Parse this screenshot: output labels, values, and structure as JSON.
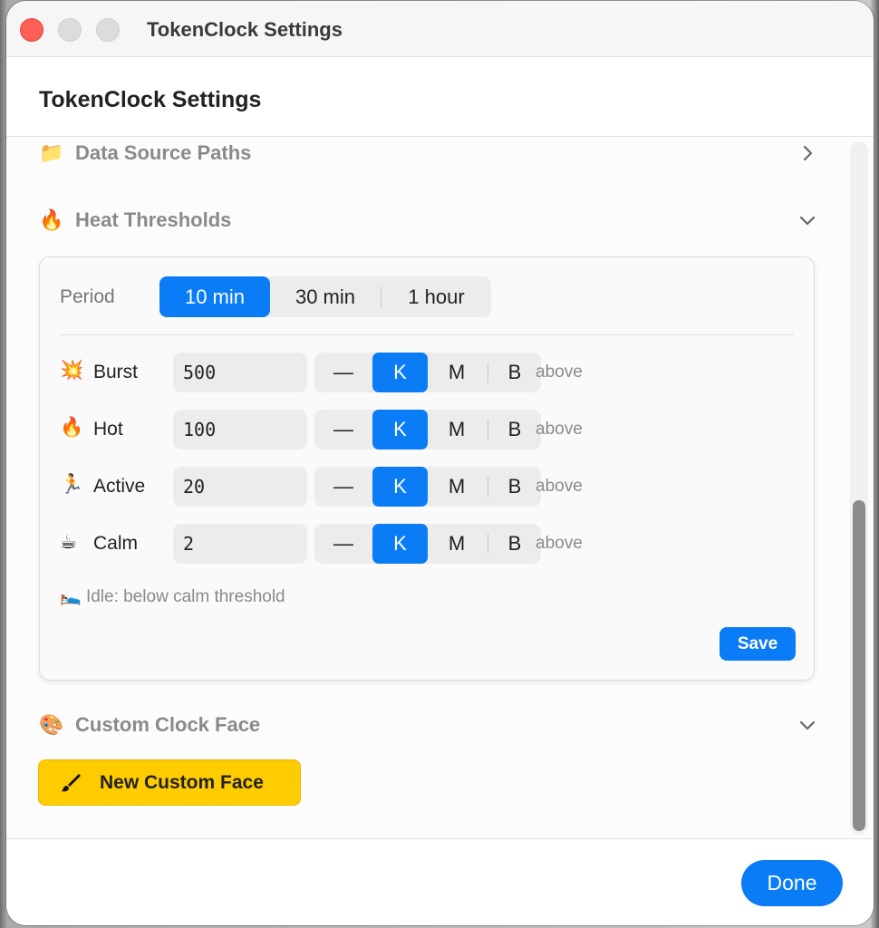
{
  "window": {
    "title": "TokenClock Settings"
  },
  "header": {
    "title": "TokenClock Settings"
  },
  "sections": {
    "data_source": {
      "emoji": "📁",
      "label": "Data Source Paths"
    },
    "heat": {
      "emoji": "🔥",
      "label": "Heat Thresholds"
    },
    "clock_face": {
      "emoji": "🎨",
      "label": "Custom Clock Face"
    }
  },
  "period": {
    "label": "Period",
    "options": [
      "10 min",
      "30 min",
      "1 hour"
    ],
    "selected": "10 min"
  },
  "thresholds": [
    {
      "emoji": "💥",
      "name": "Burst",
      "value": "500",
      "unit": "K"
    },
    {
      "emoji": "🔥",
      "name": "Hot",
      "value": "100",
      "unit": "K"
    },
    {
      "emoji": "🏃",
      "name": "Active",
      "value": "20",
      "unit": "K"
    },
    {
      "emoji": "☕",
      "name": "Calm",
      "value": "2",
      "unit": "K"
    }
  ],
  "units": {
    "none": "—",
    "k": "K",
    "m": "M",
    "b": "B"
  },
  "above_label": "above",
  "idle": {
    "emoji": "🛌",
    "text": "Idle: below calm threshold"
  },
  "save_label": "Save",
  "new_face_label": "New Custom Face",
  "done_label": "Done",
  "icons": {
    "chevron_right": "chevron-right-icon",
    "chevron_down": "chevron-down-icon",
    "brush": "paintbrush-icon"
  },
  "colors": {
    "accent": "#0a7cf5",
    "yellow": "#ffcc00",
    "close": "#fe5f57"
  }
}
